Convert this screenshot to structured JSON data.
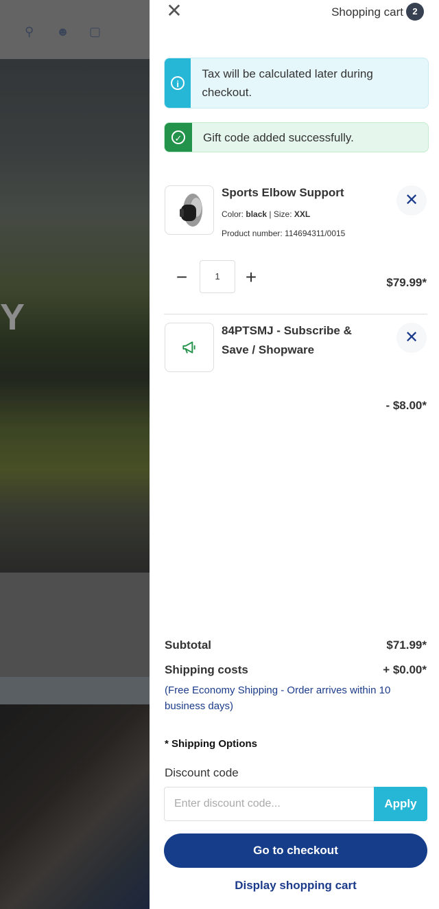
{
  "header": {
    "title": "Shopping cart",
    "count": "2",
    "close_icon": "close-icon"
  },
  "background": {
    "hero_letter": "Y"
  },
  "alerts": {
    "info": "Tax will be calculated later during checkout.",
    "success": "Gift code added successfully."
  },
  "items": [
    {
      "name": "Sports Elbow Support",
      "color_label": "Color:",
      "color": "black",
      "size_label": "Size:",
      "size": "XXL",
      "product_number": "Product number: 114694311/0015",
      "quantity": "1",
      "price": "$79.99*"
    },
    {
      "name": "84PTSMJ - Subscribe & Save / Shopware",
      "price": "- $8.00*",
      "icon": "megaphone-icon"
    }
  ],
  "summary": {
    "subtotal_label": "Subtotal",
    "subtotal_value": "$71.99*",
    "shipping_label": "Shipping costs",
    "shipping_value": "+ $0.00*",
    "shipping_note": "(Free Economy Shipping - Order arrives within 10 business days)",
    "shipping_options": "* Shipping Options"
  },
  "discount": {
    "label": "Discount code",
    "placeholder": "Enter discount code...",
    "apply_label": "Apply"
  },
  "actions": {
    "checkout_label": "Go to checkout",
    "display_cart_label": "Display shopping cart"
  },
  "colors": {
    "primary": "#153d8a",
    "info": "#26b6d6",
    "success": "#23924a"
  }
}
